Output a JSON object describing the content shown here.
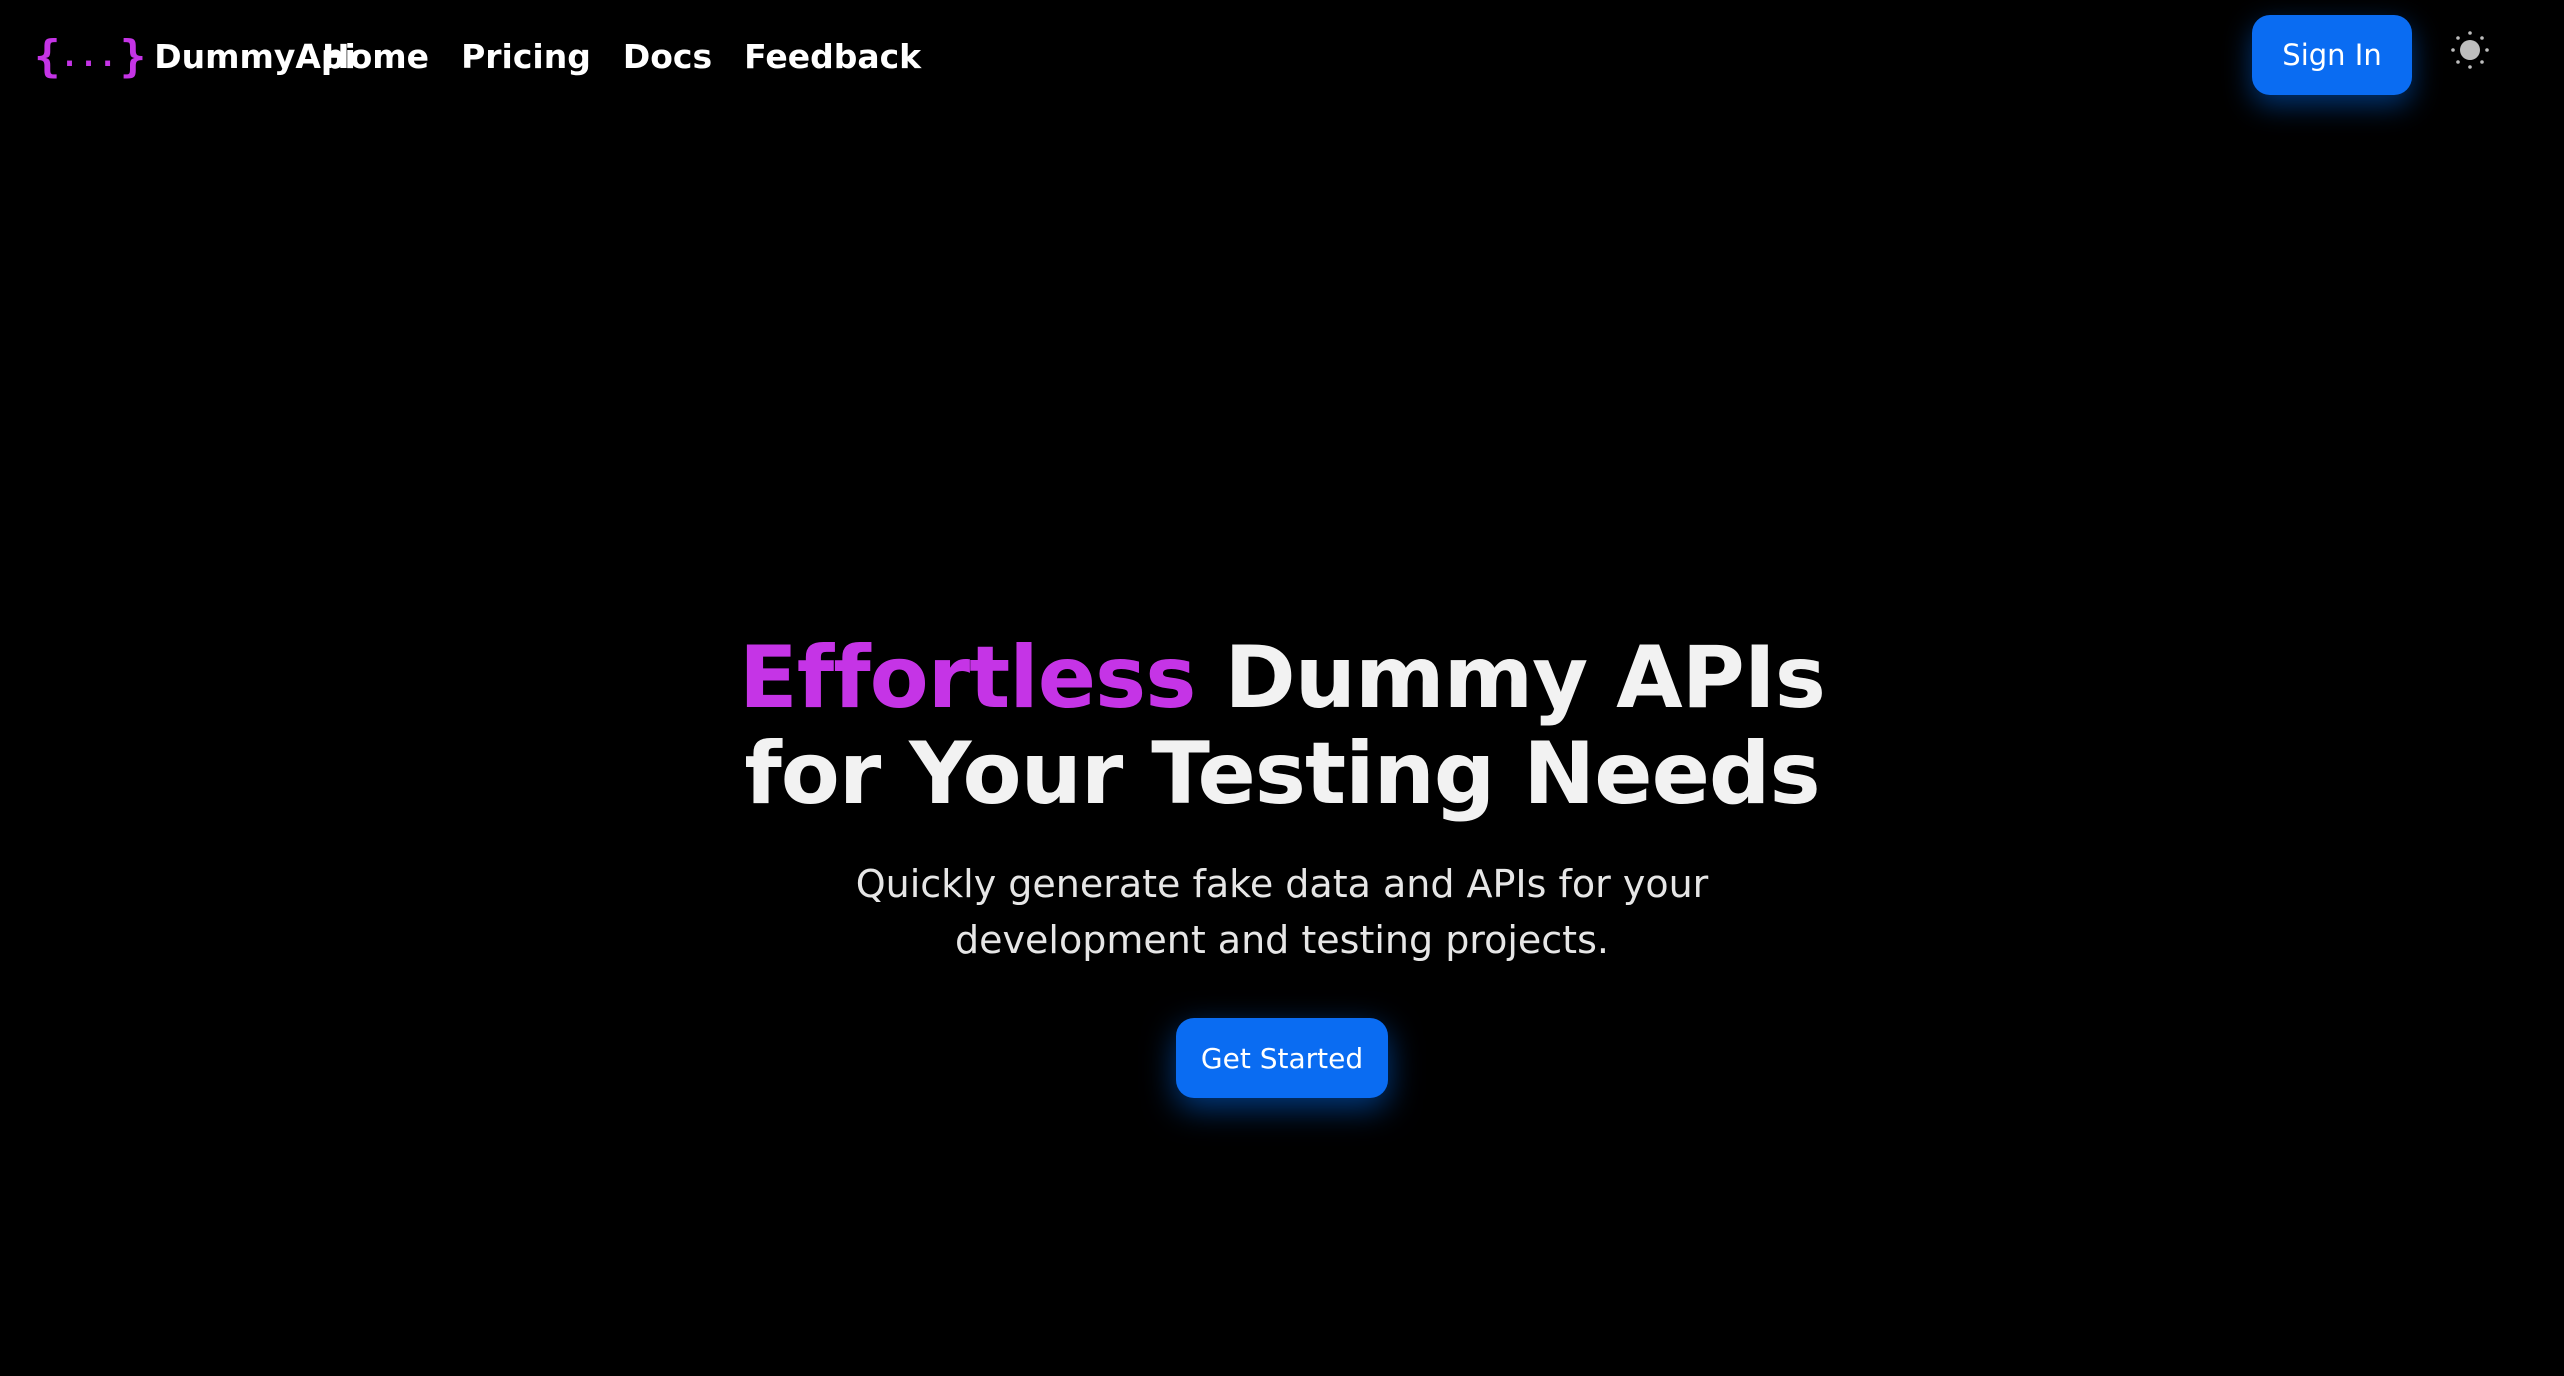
{
  "colors": {
    "background": "#000000",
    "accent_purple": "#c534e6",
    "primary_blue": "#0a6cf2",
    "text": "#ffffff",
    "theme_icon": "#bdbdbd"
  },
  "brand": {
    "logo_open": "{",
    "logo_dots": "...",
    "logo_close": "}",
    "name": "DummyApi"
  },
  "nav": {
    "items": [
      {
        "label": "Home"
      },
      {
        "label": "Pricing"
      },
      {
        "label": "Docs"
      },
      {
        "label": "Feedback"
      }
    ]
  },
  "header": {
    "signin_label": "Sign In",
    "theme_icon": "sun-icon"
  },
  "hero": {
    "title_highlight": "Effortless",
    "title_rest_line1": " Dummy APIs",
    "title_line2": "for Your Testing Needs",
    "subtitle": "Quickly generate fake data and APIs for your development and testing projects.",
    "cta_label": "Get Started"
  }
}
